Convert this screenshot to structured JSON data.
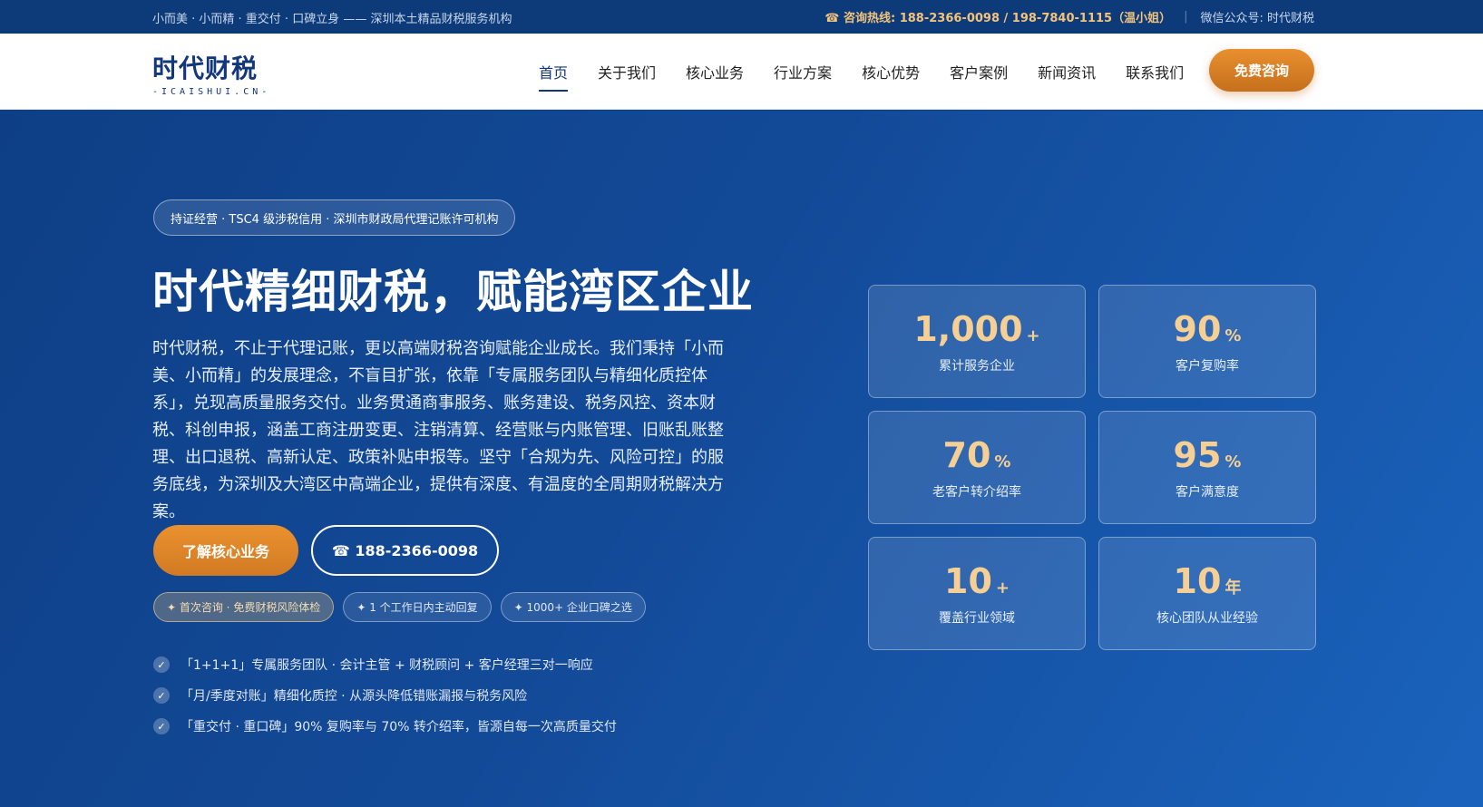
{
  "topbar": {
    "slogan": "小而美 · 小而精 · 重交付 · 口碑立身 —— 深圳本土精品财税服务机构",
    "hotline": "☎ 咨询热线: 188-2366-0098 / 198-7840-1115（温小姐）",
    "wechat": "微信公众号: 时代财税"
  },
  "header": {
    "logo_cn": "时代财税",
    "logo_en": "-ICAISHUI.CN-",
    "nav": [
      "首页",
      "关于我们",
      "核心业务",
      "行业方案",
      "核心优势",
      "客户案例",
      "新闻资讯",
      "联系我们"
    ],
    "active_nav": "首页",
    "cta": "免费咨询"
  },
  "hero": {
    "badge": "持证经营 · TSC4 级涉税信用 · 深圳市财政局代理记账许可机构",
    "headline": "时代精细财税，赋能湾区企业",
    "description": "时代财税，不止于代理记账，更以高端财税咨询赋能企业成长。我们秉持「小而美、小而精」的发展理念，不盲目扩张，依靠「专属服务团队与精细化质控体系」，兑现高质量服务交付。业务贯通商事服务、账务建设、税务风控、资本财税、科创申报，涵盖工商注册变更、注销清算、经营账与内账管理、旧账乱账整理、出口退税、高新认定、政策补贴申报等。坚守「合规为先、风险可控」的服务底线，为深圳及大湾区中高端企业，提供有深度、有温度的全周期财税解决方案。",
    "primary_button": "了解核心业务",
    "phone_button": "☎ 188-2366-0098",
    "chips": [
      "✦ 首次咨询 · 免费财税风险体检",
      "✦ 1 个工作日内主动回复",
      "✦ 1000+ 企业口碑之选"
    ],
    "checks": [
      "「1+1+1」专属服务团队 · 会计主管 + 财税顾问 + 客户经理三对一响应",
      "「月/季度对账」精细化质控 · 从源头降低错账漏报与税务风险",
      "「重交付 · 重口碑」90% 复购率与 70% 转介绍率，皆源自每一次高质量交付"
    ]
  },
  "stats": [
    {
      "num": "1,000",
      "unit": "+",
      "label": "累计服务企业"
    },
    {
      "num": "90",
      "unit": "%",
      "label": "客户复购率"
    },
    {
      "num": "70",
      "unit": "%",
      "label": "老客户转介绍率"
    },
    {
      "num": "95",
      "unit": "%",
      "label": "客户满意度"
    },
    {
      "num": "10",
      "unit": "+",
      "label": "覆盖行业领域"
    },
    {
      "num": "10",
      "unit": "年",
      "label": "核心团队从业经验"
    }
  ],
  "colors": {
    "primary_blue": "#12377a",
    "accent_orange": "#e08a2c",
    "stat_gold": "#f5cf94"
  }
}
